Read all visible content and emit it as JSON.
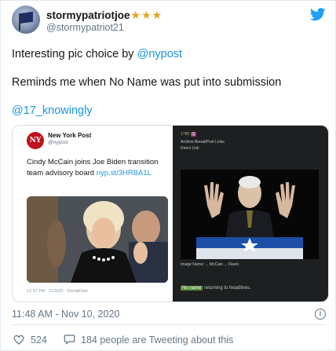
{
  "author": {
    "display_name": "stormypatriotjoe",
    "stars": "★★★",
    "handle": "@stormypatriot21"
  },
  "tweet": {
    "line1_prefix": "Interesting pic choice by ",
    "line1_mention": "@nypost",
    "line2": "Reminds me when No Name was put into submission",
    "line3": "@17_knowingly"
  },
  "media": {
    "left": {
      "logo_text": "NY",
      "account_name": "New York Post",
      "account_handle": "@nypost",
      "text": "Cindy McCain joins Joe Biden transition team advisory board ",
      "link": "nyp.st/3HRBA1L",
      "footer": "12:57 PM · 11/9/20 · SocialFlow"
    },
    "right": {
      "header_line1": "1795",
      "header_line2": "Archive Bread/Post Links",
      "header_line3": "Direct Link",
      "tag": "Q",
      "body": "Image Name: ... McCain ... Flavio",
      "noname_highlight": "No name",
      "noname_rest": " returning to headlines."
    }
  },
  "footer": {
    "timestamp": "11:48 AM - Nov 10, 2020",
    "info_glyph": "i",
    "like_count": "524",
    "reply_text": "184 people are Tweeting about this"
  },
  "colors": {
    "brand_blue": "#1da1f2",
    "link_blue": "#1b95e0",
    "star_gold": "#e8a317",
    "muted_gray": "#657786"
  }
}
